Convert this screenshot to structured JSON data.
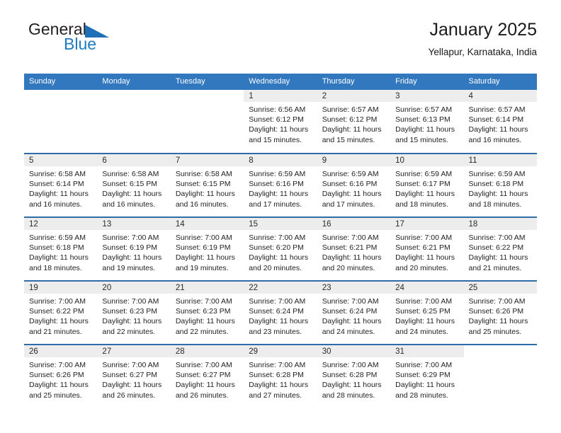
{
  "brand": {
    "name_top": "General",
    "name_bottom": "Blue",
    "triangle_icon": "brand-triangle-icon",
    "colors": {
      "blue": "#1f7bc1",
      "dark": "#231f20"
    }
  },
  "header": {
    "title": "January 2025",
    "subtitle": "Yellapur, Karnataka, India"
  },
  "theme": {
    "header_bg": "#3278be",
    "row_border": "#2e6da9",
    "daynum_bg": "#ededed"
  },
  "calendar": {
    "weekdays": [
      "Sunday",
      "Monday",
      "Tuesday",
      "Wednesday",
      "Thursday",
      "Friday",
      "Saturday"
    ],
    "weeks": [
      [
        {
          "day": ""
        },
        {
          "day": ""
        },
        {
          "day": ""
        },
        {
          "day": "1",
          "sunrise": "Sunrise: 6:56 AM",
          "sunset": "Sunset: 6:12 PM",
          "daylight": "Daylight: 11 hours and 15 minutes."
        },
        {
          "day": "2",
          "sunrise": "Sunrise: 6:57 AM",
          "sunset": "Sunset: 6:12 PM",
          "daylight": "Daylight: 11 hours and 15 minutes."
        },
        {
          "day": "3",
          "sunrise": "Sunrise: 6:57 AM",
          "sunset": "Sunset: 6:13 PM",
          "daylight": "Daylight: 11 hours and 15 minutes."
        },
        {
          "day": "4",
          "sunrise": "Sunrise: 6:57 AM",
          "sunset": "Sunset: 6:14 PM",
          "daylight": "Daylight: 11 hours and 16 minutes."
        }
      ],
      [
        {
          "day": "5",
          "sunrise": "Sunrise: 6:58 AM",
          "sunset": "Sunset: 6:14 PM",
          "daylight": "Daylight: 11 hours and 16 minutes."
        },
        {
          "day": "6",
          "sunrise": "Sunrise: 6:58 AM",
          "sunset": "Sunset: 6:15 PM",
          "daylight": "Daylight: 11 hours and 16 minutes."
        },
        {
          "day": "7",
          "sunrise": "Sunrise: 6:58 AM",
          "sunset": "Sunset: 6:15 PM",
          "daylight": "Daylight: 11 hours and 16 minutes."
        },
        {
          "day": "8",
          "sunrise": "Sunrise: 6:59 AM",
          "sunset": "Sunset: 6:16 PM",
          "daylight": "Daylight: 11 hours and 17 minutes."
        },
        {
          "day": "9",
          "sunrise": "Sunrise: 6:59 AM",
          "sunset": "Sunset: 6:16 PM",
          "daylight": "Daylight: 11 hours and 17 minutes."
        },
        {
          "day": "10",
          "sunrise": "Sunrise: 6:59 AM",
          "sunset": "Sunset: 6:17 PM",
          "daylight": "Daylight: 11 hours and 18 minutes."
        },
        {
          "day": "11",
          "sunrise": "Sunrise: 6:59 AM",
          "sunset": "Sunset: 6:18 PM",
          "daylight": "Daylight: 11 hours and 18 minutes."
        }
      ],
      [
        {
          "day": "12",
          "sunrise": "Sunrise: 6:59 AM",
          "sunset": "Sunset: 6:18 PM",
          "daylight": "Daylight: 11 hours and 18 minutes."
        },
        {
          "day": "13",
          "sunrise": "Sunrise: 7:00 AM",
          "sunset": "Sunset: 6:19 PM",
          "daylight": "Daylight: 11 hours and 19 minutes."
        },
        {
          "day": "14",
          "sunrise": "Sunrise: 7:00 AM",
          "sunset": "Sunset: 6:19 PM",
          "daylight": "Daylight: 11 hours and 19 minutes."
        },
        {
          "day": "15",
          "sunrise": "Sunrise: 7:00 AM",
          "sunset": "Sunset: 6:20 PM",
          "daylight": "Daylight: 11 hours and 20 minutes."
        },
        {
          "day": "16",
          "sunrise": "Sunrise: 7:00 AM",
          "sunset": "Sunset: 6:21 PM",
          "daylight": "Daylight: 11 hours and 20 minutes."
        },
        {
          "day": "17",
          "sunrise": "Sunrise: 7:00 AM",
          "sunset": "Sunset: 6:21 PM",
          "daylight": "Daylight: 11 hours and 20 minutes."
        },
        {
          "day": "18",
          "sunrise": "Sunrise: 7:00 AM",
          "sunset": "Sunset: 6:22 PM",
          "daylight": "Daylight: 11 hours and 21 minutes."
        }
      ],
      [
        {
          "day": "19",
          "sunrise": "Sunrise: 7:00 AM",
          "sunset": "Sunset: 6:22 PM",
          "daylight": "Daylight: 11 hours and 21 minutes."
        },
        {
          "day": "20",
          "sunrise": "Sunrise: 7:00 AM",
          "sunset": "Sunset: 6:23 PM",
          "daylight": "Daylight: 11 hours and 22 minutes."
        },
        {
          "day": "21",
          "sunrise": "Sunrise: 7:00 AM",
          "sunset": "Sunset: 6:23 PM",
          "daylight": "Daylight: 11 hours and 22 minutes."
        },
        {
          "day": "22",
          "sunrise": "Sunrise: 7:00 AM",
          "sunset": "Sunset: 6:24 PM",
          "daylight": "Daylight: 11 hours and 23 minutes."
        },
        {
          "day": "23",
          "sunrise": "Sunrise: 7:00 AM",
          "sunset": "Sunset: 6:24 PM",
          "daylight": "Daylight: 11 hours and 24 minutes."
        },
        {
          "day": "24",
          "sunrise": "Sunrise: 7:00 AM",
          "sunset": "Sunset: 6:25 PM",
          "daylight": "Daylight: 11 hours and 24 minutes."
        },
        {
          "day": "25",
          "sunrise": "Sunrise: 7:00 AM",
          "sunset": "Sunset: 6:26 PM",
          "daylight": "Daylight: 11 hours and 25 minutes."
        }
      ],
      [
        {
          "day": "26",
          "sunrise": "Sunrise: 7:00 AM",
          "sunset": "Sunset: 6:26 PM",
          "daylight": "Daylight: 11 hours and 25 minutes."
        },
        {
          "day": "27",
          "sunrise": "Sunrise: 7:00 AM",
          "sunset": "Sunset: 6:27 PM",
          "daylight": "Daylight: 11 hours and 26 minutes."
        },
        {
          "day": "28",
          "sunrise": "Sunrise: 7:00 AM",
          "sunset": "Sunset: 6:27 PM",
          "daylight": "Daylight: 11 hours and 26 minutes."
        },
        {
          "day": "29",
          "sunrise": "Sunrise: 7:00 AM",
          "sunset": "Sunset: 6:28 PM",
          "daylight": "Daylight: 11 hours and 27 minutes."
        },
        {
          "day": "30",
          "sunrise": "Sunrise: 7:00 AM",
          "sunset": "Sunset: 6:28 PM",
          "daylight": "Daylight: 11 hours and 28 minutes."
        },
        {
          "day": "31",
          "sunrise": "Sunrise: 7:00 AM",
          "sunset": "Sunset: 6:29 PM",
          "daylight": "Daylight: 11 hours and 28 minutes."
        },
        {
          "day": ""
        }
      ]
    ]
  }
}
